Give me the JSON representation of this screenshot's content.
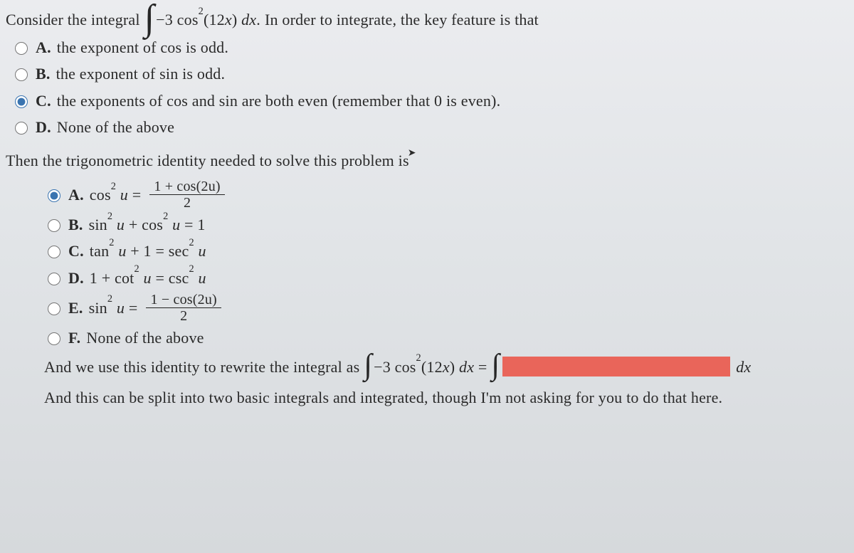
{
  "intro": {
    "prefix": "Consider the integral",
    "integrand": "−3 cos²(12x) dx.",
    "suffix": "In order to integrate, the key feature is that"
  },
  "q1": {
    "choices": [
      {
        "label": "A.",
        "text": "the exponent of cos is odd."
      },
      {
        "label": "B.",
        "text": "the exponent of sin is odd."
      },
      {
        "label": "C.",
        "text": "the exponents of cos and sin are both even (remember that 0 is even)."
      },
      {
        "label": "D.",
        "text": "None of the above"
      }
    ],
    "selected_index": 2
  },
  "q2_intro": "Then the trigonometric identity needed to solve this problem is",
  "q2": {
    "choices": {
      "A": {
        "label": "A.",
        "lhs": "cos² u =",
        "num": "1 + cos(2u)",
        "den": "2"
      },
      "B": {
        "label": "B.",
        "text": "sin² u + cos² u = 1"
      },
      "C": {
        "label": "C.",
        "text": "tan² u + 1 = sec² u"
      },
      "D": {
        "label": "D.",
        "text": "1 + cot² u = csc² u"
      },
      "E": {
        "label": "E.",
        "lhs": "sin² u =",
        "num": "1 − cos(2u)",
        "den": "2"
      },
      "F": {
        "label": "F.",
        "text": "None of the above"
      }
    },
    "selected_index": 0
  },
  "rewrite": {
    "prefix": "And we use this identity to rewrite the integral as",
    "integrand": "−3 cos²(12x) dx =",
    "dx": "dx"
  },
  "final": "And this can be split into two basic integrals and integrated, though I'm not asking for you to do that here."
}
